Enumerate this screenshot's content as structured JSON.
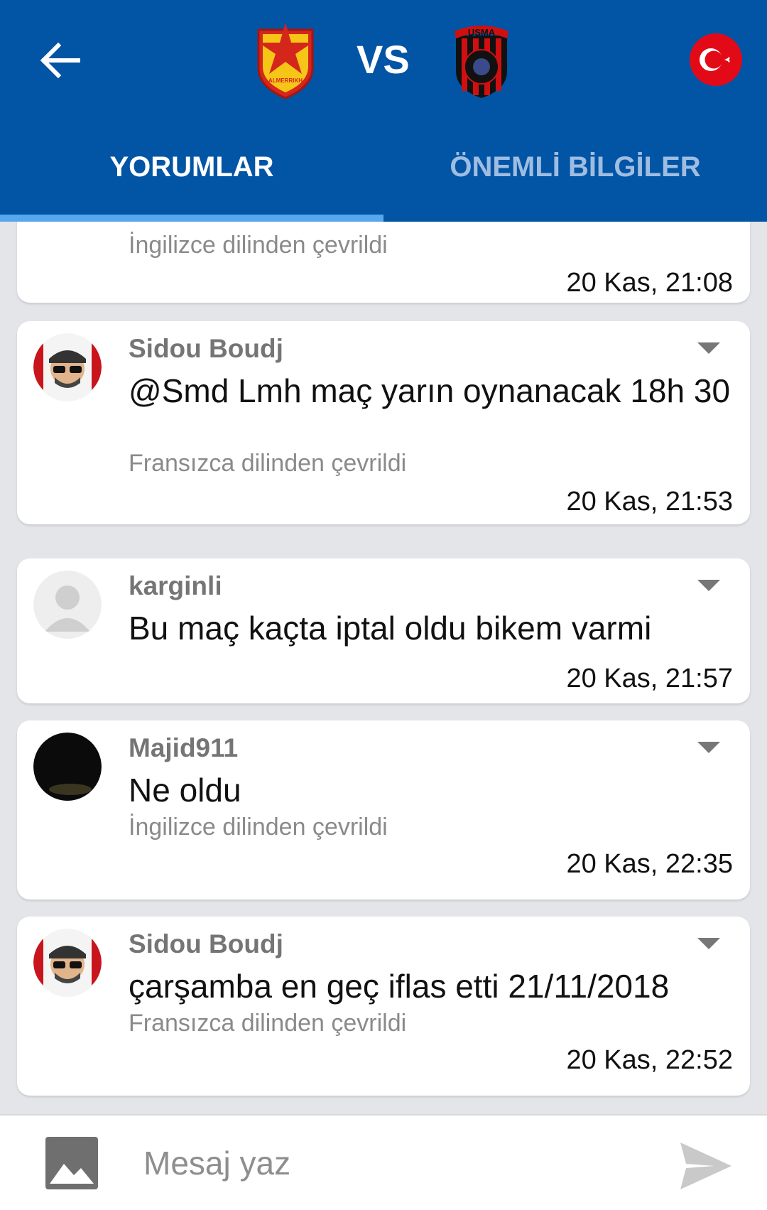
{
  "header": {
    "vs_text": "VS",
    "home_crest_text": "ALMERRIKH",
    "away_crest_text": "USMA",
    "tabs": [
      {
        "label": "YORUMLAR",
        "active": true
      },
      {
        "label": "ÖNEMLİ BİLGİLER",
        "active": false
      }
    ],
    "colors": {
      "bar": "#0254a5",
      "indicator": "#56a7ee"
    }
  },
  "comments": [
    {
      "author": "",
      "message": "",
      "translation": "İngilizce dilinden çevrildi",
      "time": "20 Kas, 21:08"
    },
    {
      "author": "Sidou Boudj",
      "message": "@Smd Lmh maç yarın oynanacak 18h 30",
      "translation": "Fransızca dilinden çevrildi",
      "time": "20 Kas, 21:53",
      "avatar": "cartoon-avatar"
    },
    {
      "author": "karginli",
      "message": "Bu maç kaçta iptal oldu bikem varmi",
      "translation": "",
      "time": "20 Kas, 21:57",
      "avatar": "default-avatar"
    },
    {
      "author": "Majid911",
      "message": "Ne oldu",
      "translation": "İngilizce dilinden çevrildi",
      "time": "20 Kas, 22:35",
      "avatar": "dark-photo-avatar"
    },
    {
      "author": "Sidou Boudj",
      "message": "çarşamba en geç iflas etti 21/11/2018",
      "translation": "Fransızca dilinden çevrildi",
      "time": "20 Kas, 22:52",
      "avatar": "cartoon-avatar"
    }
  ],
  "composer": {
    "placeholder": "Mesaj yaz",
    "image_icon": "image-icon",
    "send_icon": "send-icon"
  }
}
